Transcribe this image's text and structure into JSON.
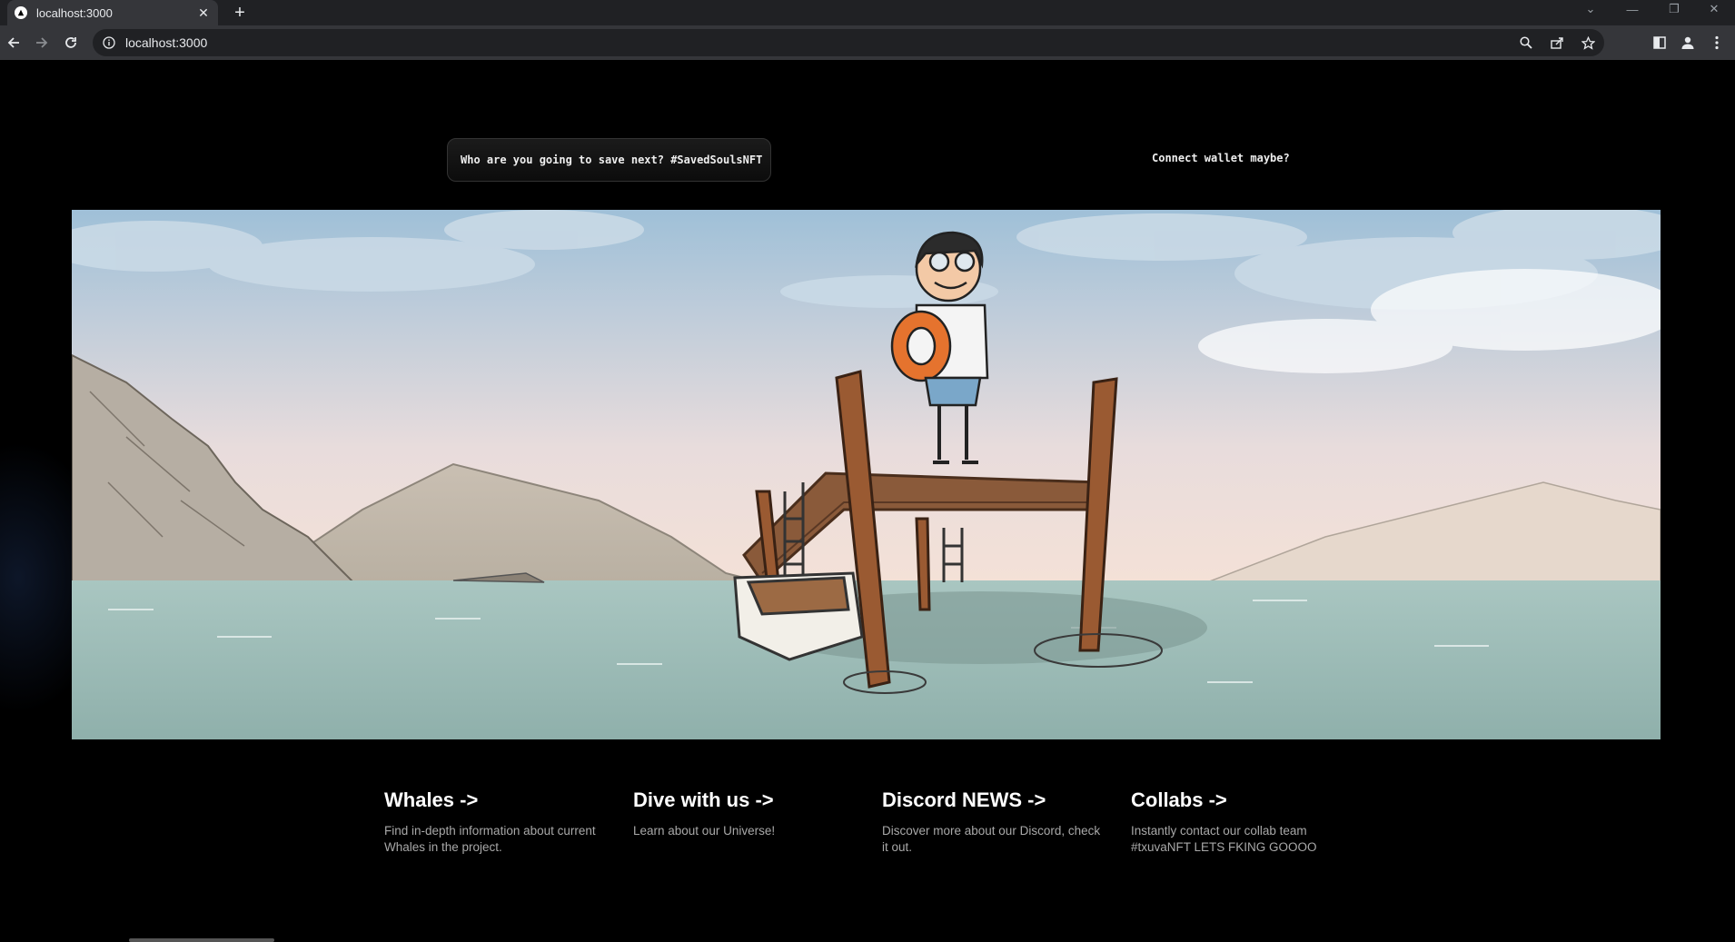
{
  "browser": {
    "tab_title": "localhost:3000",
    "url": "localhost:3000"
  },
  "header": {
    "description": "Who are you going to save next? #SavedSoulsNFT",
    "connect_label": "Connect wallet maybe?"
  },
  "cards": [
    {
      "title": "Whales ->",
      "text": "Find in-depth information about current Whales in the project."
    },
    {
      "title": "Dive with us ->",
      "text": "Learn about our Universe!"
    },
    {
      "title": "Discord NEWS ->",
      "text": "Discover more about our Discord, check it out."
    },
    {
      "title": "Collabs ->",
      "text": "Instantly contact our collab team #txuvaNFT LETS FKING GOOOO"
    }
  ],
  "icons": {
    "back": "arrow-left-icon",
    "forward": "arrow-right-icon",
    "reload": "reload-icon",
    "info": "info-icon",
    "zoom": "zoom-icon",
    "share": "share-icon",
    "bookmark": "star-icon",
    "side_panel": "side-panel-icon",
    "profile": "profile-icon",
    "menu": "kebab-menu-icon"
  }
}
